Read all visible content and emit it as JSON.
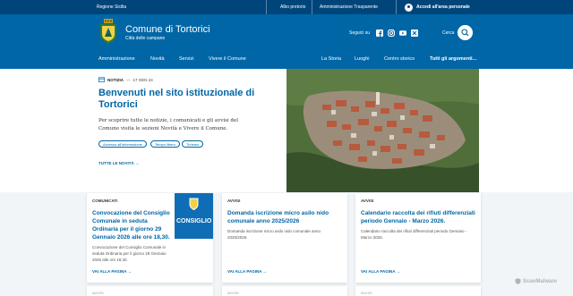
{
  "topbar": {
    "region": "Regione Sicilia",
    "links": [
      "Albo pretorio",
      "Amministrazione Trasparente"
    ],
    "access": "Accedi all'area personale"
  },
  "header": {
    "title": "Comune di Tortorici",
    "tagline": "Città delle campane",
    "follow_label": "Seguici su",
    "social_icons": [
      "facebook-icon",
      "instagram-icon",
      "youtube-icon",
      "x-icon"
    ],
    "search_label": "Cerca"
  },
  "nav": {
    "left": [
      "Amministrazione",
      "Novità",
      "Servizi",
      "Vivere il Comune"
    ],
    "right": [
      "La Storia",
      "Luoghi",
      "Centro storico"
    ],
    "all_topics": "Tutti gli argomenti..."
  },
  "hero": {
    "category": "NOTIZIA",
    "date": "17 GEN 24",
    "title": "Benvenuti nel sito istituzionale di Tortorici",
    "text": "Per scoprire tutte le notizie, i comunicati e gli avvisi del Comune visita le sezioni Novità e Vivere il Comune.",
    "chips": [
      "Accesso all'informazione",
      "Tempo libero",
      "Turismo"
    ],
    "all_news": "TUTTE LE NOVITÀ"
  },
  "cards": [
    {
      "label": "COMUNICATI",
      "title": "Convocazione del Consiglio Comunale in seduta Ordinaria per il giorno 29 Gennaio 2026 alle ore 18,30.",
      "text": "Convocazione del Consiglio Comunale in seduta Ordinaria per il giorno 29 Gennaio 2026 alle ore 18,30.",
      "cta": "VAI ALLA PAGINA",
      "badge": "CONSIGLIO"
    },
    {
      "label": "AVVISI",
      "title": "Domanda iscrizione micro asilo nido comunale anno 2025/2026",
      "text": "Domanda iscrizione micro asilo nido comunale anno 2025/2026.",
      "cta": "VAI ALLA PAGINA"
    },
    {
      "label": "AVVISI",
      "title": "Calendario raccolta dei rifiuti differenziati periodo Gennaio - Marzo 2026.",
      "text": "Calendario raccolta dei rifiuti differenziati periodo Gennaio - Marzo 2026.",
      "cta": "VAI ALLA PAGINA"
    }
  ],
  "more_cards": [
    "AVVISI",
    "AVVISI",
    "AVVISI"
  ],
  "watermark": "ScanMalware",
  "colors": {
    "primary": "#0066a6",
    "topbar": "#00457a",
    "background": "#f2f5f8"
  }
}
